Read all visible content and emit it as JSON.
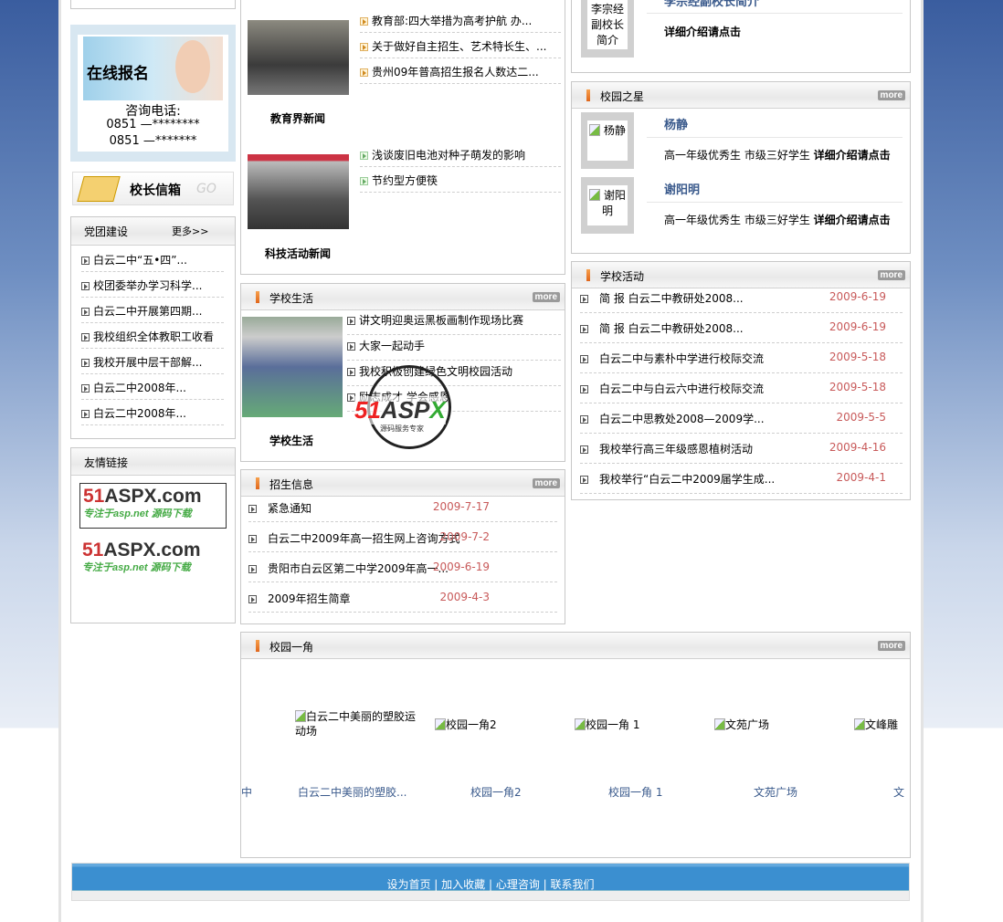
{
  "left": {
    "signup": {
      "banner": "在线报名",
      "phone_label": "咨询电话:",
      "phones": [
        "0851 —********",
        "0851 —*******"
      ]
    },
    "mailbox": {
      "label": "校长信箱",
      "go": "GO"
    },
    "party": {
      "title": "党团建设",
      "more": "更多>>",
      "items": [
        "白云二中“五•四”...",
        "校团委举办学习科学...",
        "白云二中开展第四期...",
        "我校组织全体教职工收看",
        "我校开展中层干部解...",
        "白云二中2008年...",
        "白云二中2008年..."
      ]
    },
    "links": {
      "title": "友情链接",
      "logos": [
        "51ASPX.com 专注于asp.net 源码下载",
        "51ASPX.com 专注于asp.net 源码下载"
      ]
    }
  },
  "news": {
    "edu": {
      "caption": "教育界新闻",
      "items": [
        "教育部:四大举措为高考护航 办...",
        "关于做好自主招生、艺术特长生、...",
        "贵州09年普高招生报名人数达二..."
      ]
    },
    "tech": {
      "caption": "科技活动新闻",
      "items": [
        "浅谈废旧电池对种子萌发的影响",
        "节约型方便筷"
      ]
    }
  },
  "life": {
    "title": "学校生活",
    "more": "more",
    "caption": "学校生活",
    "items": [
      "讲文明迎奥运黑板画制作现场比赛",
      "大家一起动手",
      "我校积极创建绿色文明校园活动",
      "励志成才 学会感恩"
    ]
  },
  "watermark": {
    "brand": "51ASPX",
    "sub": "源码服务专家"
  },
  "admission": {
    "title": "招生信息",
    "more": "more",
    "items": [
      {
        "t": "紧急通知",
        "d": "2009-7-17"
      },
      {
        "t": "白云二中2009年高一招生网上咨询方式",
        "d": "2009-7-2"
      },
      {
        "t": "贵阳市白云区第二中学2009年高一...",
        "d": "2009-6-19"
      },
      {
        "t": "2009年招生简章",
        "d": "2009-4-3"
      }
    ]
  },
  "principal": {
    "title": "李宗经副校长简介",
    "img_alt": "李宗经副校长简介",
    "detail": "详细介绍请点击"
  },
  "stars": {
    "title": "校园之星",
    "more": "more",
    "items": [
      {
        "name": "杨静",
        "alt": "杨静",
        "desc": "高一年级优秀生 市级三好学生",
        "link": "详细介绍请点击"
      },
      {
        "name": "谢阳明",
        "alt": "谢阳明",
        "desc": "高一年级优秀生 市级三好学生",
        "link": "详细介绍请点击"
      }
    ]
  },
  "activities": {
    "title": "学校活动",
    "more": "more",
    "items": [
      {
        "t": "简 报 白云二中教研处2008...",
        "d": "2009-6-19"
      },
      {
        "t": "简 报 白云二中教研处2008...",
        "d": "2009-6-19"
      },
      {
        "t": "白云二中与素朴中学进行校际交流",
        "d": "2009-5-18"
      },
      {
        "t": "白云二中与白云六中进行校际交流",
        "d": "2009-5-18"
      },
      {
        "t": "白云二中思教处2008—2009学...",
        "d": "2009-5-5"
      },
      {
        "t": "我校举行高三年级感恩植树活动",
        "d": "2009-4-16"
      },
      {
        "t": "我校举行“白云二中2009届学生成...",
        "d": "2009-4-1"
      }
    ]
  },
  "campus": {
    "title": "校园一角",
    "more": "more",
    "lead_caption": "中",
    "items": [
      {
        "alt": "白云二中美丽的塑胶运动场",
        "caption": "白云二中美丽的塑胶..."
      },
      {
        "alt": "校园一角2",
        "caption": "校园一角2"
      },
      {
        "alt": "校园一角 1",
        "caption": "校园一角 1"
      },
      {
        "alt": "文苑广场",
        "caption": "文苑广场"
      },
      {
        "alt": "文峰雕",
        "caption": "文"
      }
    ]
  },
  "footer": {
    "links": [
      "设为首页",
      "加入收藏",
      "心理咨询",
      "联系我们"
    ]
  }
}
